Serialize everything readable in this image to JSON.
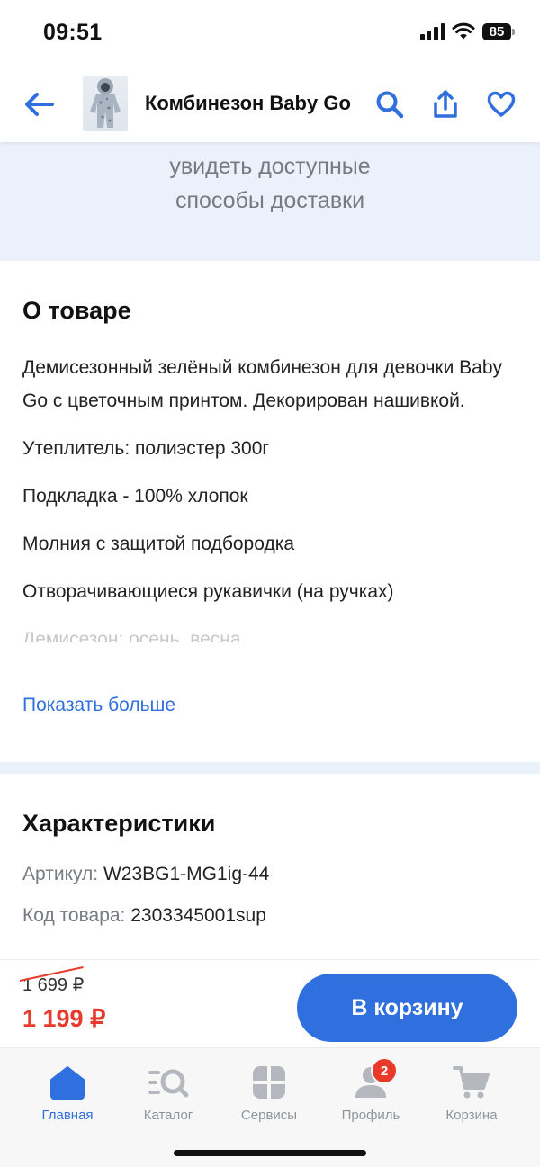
{
  "status_bar": {
    "time": "09:51",
    "battery": "85"
  },
  "header": {
    "title": "Комбинезон Baby Go",
    "back_icon": "arrow-left-icon",
    "search_icon": "search-icon",
    "share_icon": "share-icon",
    "favorite_icon": "heart-icon"
  },
  "delivery": {
    "line1": "увидеть доступные",
    "line2": "способы доставки"
  },
  "about": {
    "title": "О товаре",
    "paragraphs": [
      "Демисезонный зелёный комбинезон для девочки Baby Go с цветочным принтом. Декорирован нашивкой.",
      "Утеплитель: полиэстер 300г",
      "Подкладка - 100% хлопок",
      "Молния с защитой подбородка",
      "Отворачивающиеся рукавички (на ручках)",
      "Демисезон: осень, весна"
    ],
    "show_more": "Показать больше"
  },
  "specs": {
    "title": "Характеристики",
    "rows": [
      {
        "label": "Артикул:",
        "value": "W23BG1-MG1ig-44"
      },
      {
        "label": "Код товара:",
        "value": "2303345001sup"
      }
    ]
  },
  "price": {
    "old": "1 699 ₽",
    "current": "1 199 ₽",
    "cart_button": "В корзину"
  },
  "tabs": [
    {
      "label": "Главная",
      "icon": "home-icon",
      "active": true
    },
    {
      "label": "Каталог",
      "icon": "catalog-icon",
      "active": false
    },
    {
      "label": "Сервисы",
      "icon": "services-icon",
      "active": false
    },
    {
      "label": "Профиль",
      "icon": "profile-icon",
      "active": false,
      "badge": "2"
    },
    {
      "label": "Корзина",
      "icon": "cart-icon",
      "active": false
    }
  ],
  "colors": {
    "accent": "#2f6fde",
    "price_red": "#e8392a",
    "banner_bg": "#eaf1fb",
    "muted_text": "#767b82"
  }
}
